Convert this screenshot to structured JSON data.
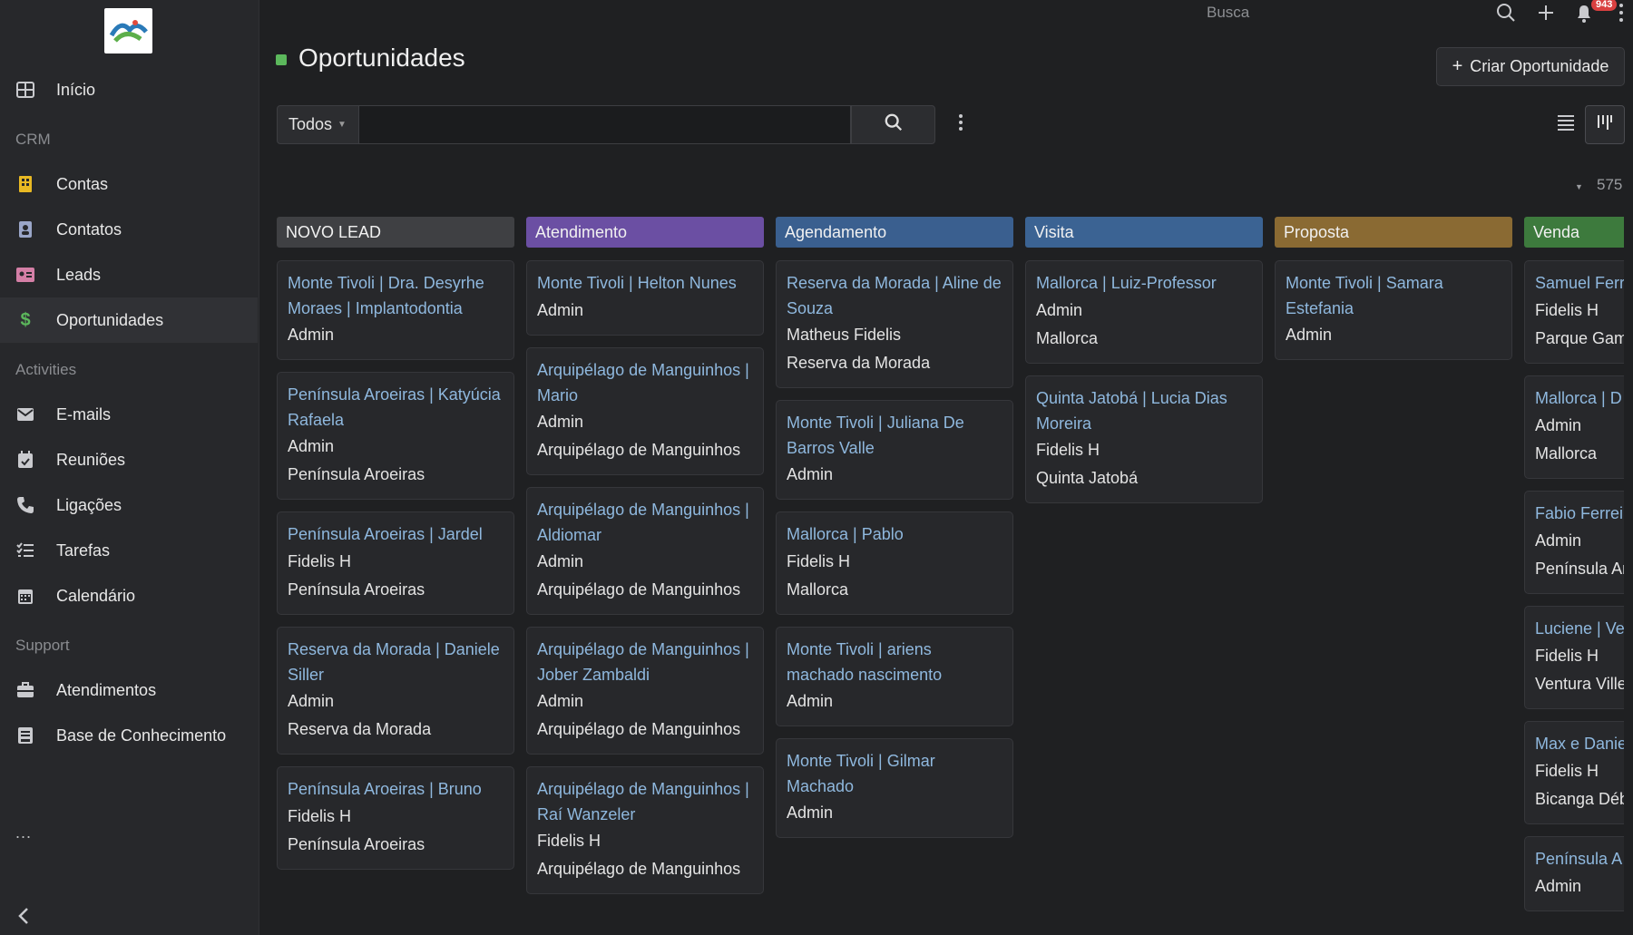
{
  "sidebar": {
    "items": [
      {
        "label": "Início"
      },
      {
        "label": "Contas"
      },
      {
        "label": "Contatos"
      },
      {
        "label": "Leads"
      },
      {
        "label": "Oportunidades"
      },
      {
        "label": "E-mails"
      },
      {
        "label": "Reuniões"
      },
      {
        "label": "Ligações"
      },
      {
        "label": "Tarefas"
      },
      {
        "label": "Calendário"
      },
      {
        "label": "Atendimentos"
      },
      {
        "label": "Base de Conhecimento"
      }
    ],
    "sections": [
      "CRM",
      "Activities",
      "Support"
    ],
    "more": "...",
    "accent_active": "#5cb85c"
  },
  "topbar": {
    "search_label": "Busca",
    "notification_count": "943"
  },
  "page": {
    "title": "Oportunidades",
    "create_button": "Criar Oportunidade",
    "filter_label": "Todos",
    "search_value": "",
    "total_count": "575"
  },
  "columns": [
    {
      "name": "NOVO LEAD",
      "color": "#3f4043",
      "cards": [
        {
          "title": "Monte Tivoli | Dra. Desyrhe Moraes | Implantodontia",
          "lines": [
            "Admin"
          ]
        },
        {
          "title": "Península Aroeiras | Katyúcia Rafaela",
          "lines": [
            "Admin",
            "Península Aroeiras"
          ]
        },
        {
          "title": "Península Aroeiras | Jardel",
          "lines": [
            "Fidelis H",
            "Península Aroeiras"
          ]
        },
        {
          "title": "Reserva da Morada | Daniele Siller",
          "lines": [
            "Admin",
            "Reserva da Morada"
          ]
        },
        {
          "title": "Península Aroeiras | Bruno",
          "lines": [
            "Fidelis H",
            "Península Aroeiras"
          ]
        }
      ]
    },
    {
      "name": "Atendimento",
      "color": "#6b4fa3",
      "cards": [
        {
          "title": "Monte Tivoli | Helton Nunes",
          "lines": [
            "Admin"
          ]
        },
        {
          "title": "Arquipélago de Manguinhos | Mario",
          "lines": [
            "Admin",
            "Arquipélago de Manguinhos"
          ]
        },
        {
          "title": "Arquipélago de Manguinhos | Aldiomar",
          "lines": [
            "Admin",
            "Arquipélago de Manguinhos"
          ]
        },
        {
          "title": "Arquipélago de Manguinhos | Jober Zambaldi",
          "lines": [
            "Admin",
            "Arquipélago de Manguinhos"
          ]
        },
        {
          "title": "Arquipélago de Manguinhos | Raí Wanzeler",
          "lines": [
            "Fidelis H",
            "Arquipélago de Manguinhos"
          ]
        }
      ]
    },
    {
      "name": "Agendamento",
      "color": "#3a5f8f",
      "cards": [
        {
          "title": "Reserva da Morada | Aline de Souza",
          "lines": [
            "Matheus Fidelis",
            "Reserva da Morada"
          ]
        },
        {
          "title": "Monte Tivoli | Juliana De Barros Valle",
          "lines": [
            "Admin"
          ]
        },
        {
          "title": "Mallorca | Pablo",
          "lines": [
            "Fidelis H",
            "Mallorca"
          ]
        },
        {
          "title": "Monte Tivoli | ariens machado nascimento",
          "lines": [
            "Admin"
          ]
        },
        {
          "title": "Monte Tivoli | Gilmar Machado",
          "lines": [
            "Admin"
          ]
        }
      ]
    },
    {
      "name": "Visita",
      "color": "#3b6393",
      "cards": [
        {
          "title": "Mallorca | Luiz-Professor",
          "lines": [
            "Admin",
            "Mallorca"
          ]
        },
        {
          "title": "Quinta Jatobá | Lucia Dias Moreira",
          "lines": [
            "Fidelis H",
            "Quinta Jatobá"
          ]
        }
      ]
    },
    {
      "name": "Proposta",
      "color": "#8a6a33",
      "cards": [
        {
          "title": "Monte Tivoli | Samara Estefania",
          "lines": [
            "Admin"
          ]
        }
      ]
    },
    {
      "name": "Venda",
      "color": "#3d7a3d",
      "cards": [
        {
          "title": "Samuel Ferr",
          "lines": [
            "Fidelis H",
            "Parque Gam"
          ]
        },
        {
          "title": "Mallorca | D",
          "lines": [
            "Admin",
            "Mallorca"
          ]
        },
        {
          "title": "Fabio Ferrei",
          "lines": [
            "Admin",
            "Península Ar"
          ]
        },
        {
          "title": "Luciene | Ve",
          "lines": [
            "Fidelis H",
            "Ventura Ville"
          ]
        },
        {
          "title": "Max e Danie Débora",
          "lines": [
            "Fidelis H",
            "Bicanga Déb"
          ]
        },
        {
          "title": "Península A Aline",
          "lines": [
            "Admin"
          ]
        }
      ]
    }
  ]
}
